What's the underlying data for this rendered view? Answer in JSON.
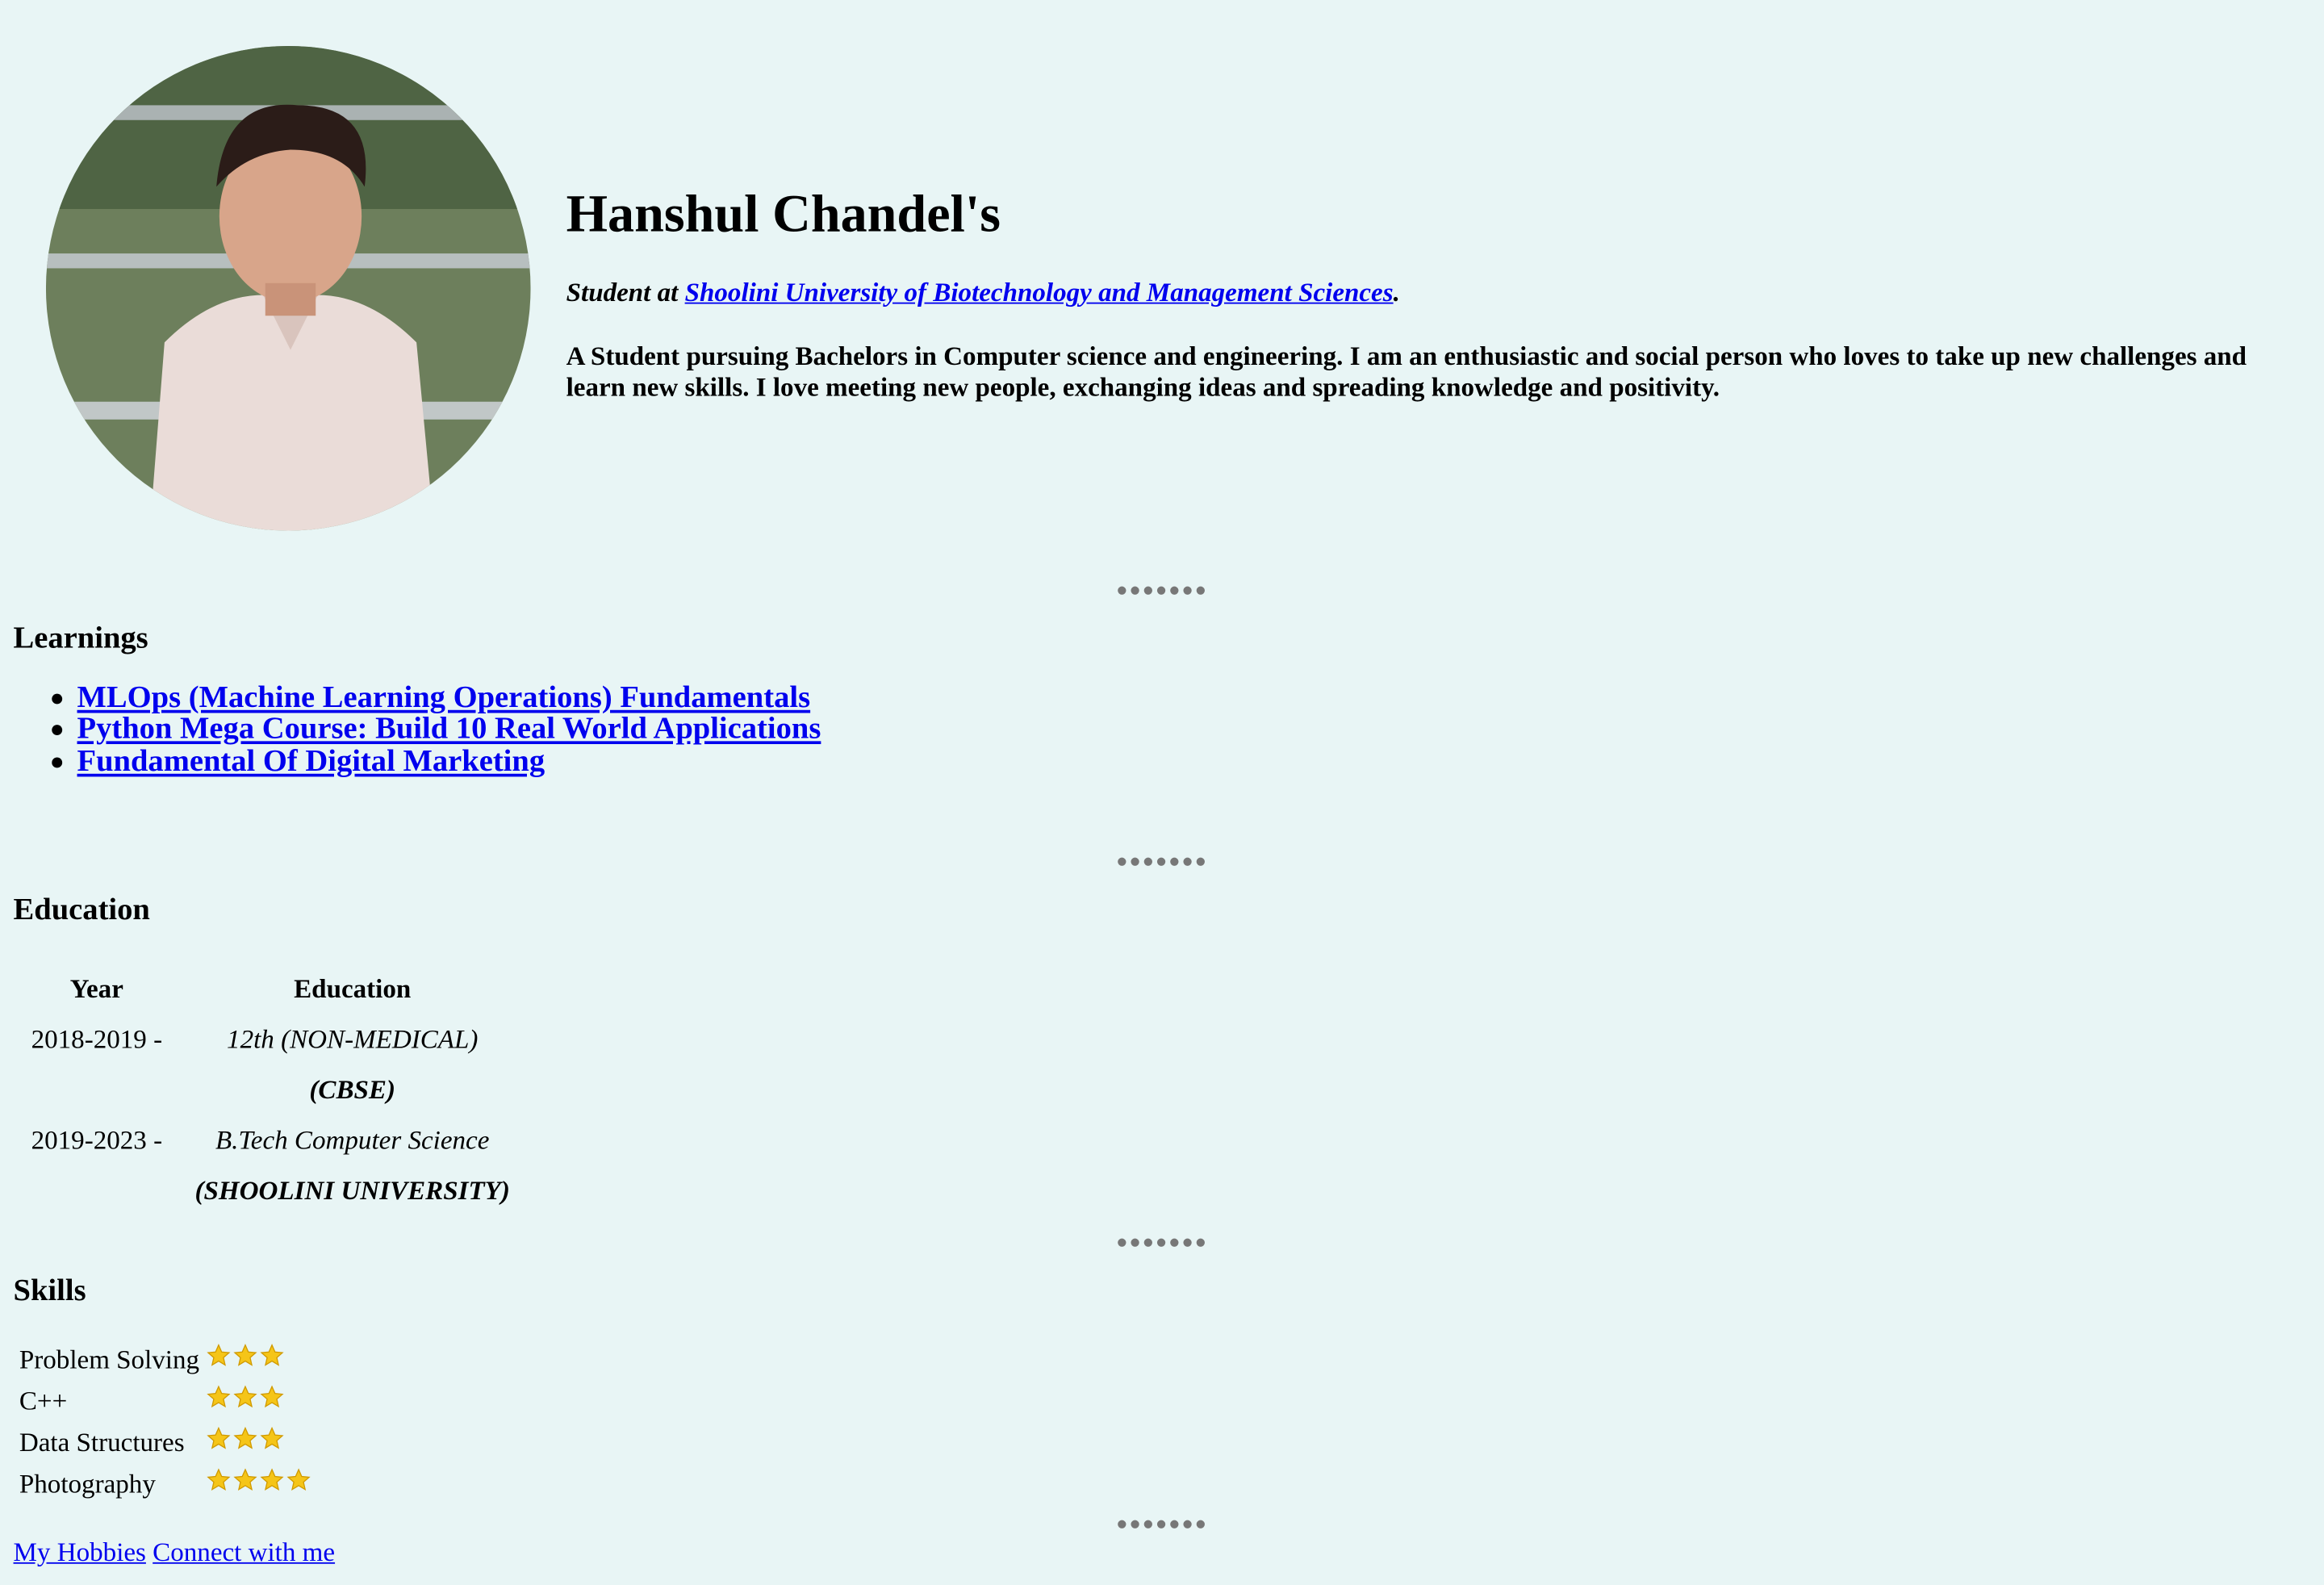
{
  "header": {
    "name": "Hanshul Chandel's",
    "role_prefix": "Student at",
    "university_link": "Shoolini University of Biotechnology and Management Sciences",
    "role_suffix": ".",
    "bio": "A Student pursuing Bachelors in Computer science and engineering. I am an enthusiastic and social person who loves to take up new challenges and learn new skills. I love meeting new people, exchanging ideas and spreading knowledge and positivity."
  },
  "divider": "●●●●●●●",
  "learnings": {
    "title": "Learnings",
    "items": [
      "MLOps (Machine Learning Operations) Fundamentals",
      "Python Mega Course: Build 10 Real World Applications",
      "Fundamental Of Digital Marketing"
    ]
  },
  "education": {
    "title": "Education",
    "headers": [
      "Year",
      "Education"
    ],
    "rows": [
      {
        "year": "2018-2019 -",
        "course": "12th (NON-MEDICAL)",
        "board": "(CBSE)"
      },
      {
        "year": "2019-2023 -",
        "course": "B.Tech Computer Science",
        "board": "(SHOOLINI UNIVERSITY)"
      }
    ]
  },
  "skills": {
    "title": "Skills",
    "items": [
      {
        "name": "Problem Solving",
        "stars": 3
      },
      {
        "name": "C++",
        "stars": 3
      },
      {
        "name": "Data Structures",
        "stars": 3
      },
      {
        "name": "Photography",
        "stars": 4
      }
    ]
  },
  "footer": {
    "hobbies_link": "My Hobbies",
    "connect_link": "Connect with me"
  },
  "colors": {
    "background": "#e8f5f5",
    "link": "#0000ee",
    "star": "#f5c518"
  },
  "icons": {
    "avatar": "profile-photo",
    "rating": "star-icon"
  }
}
